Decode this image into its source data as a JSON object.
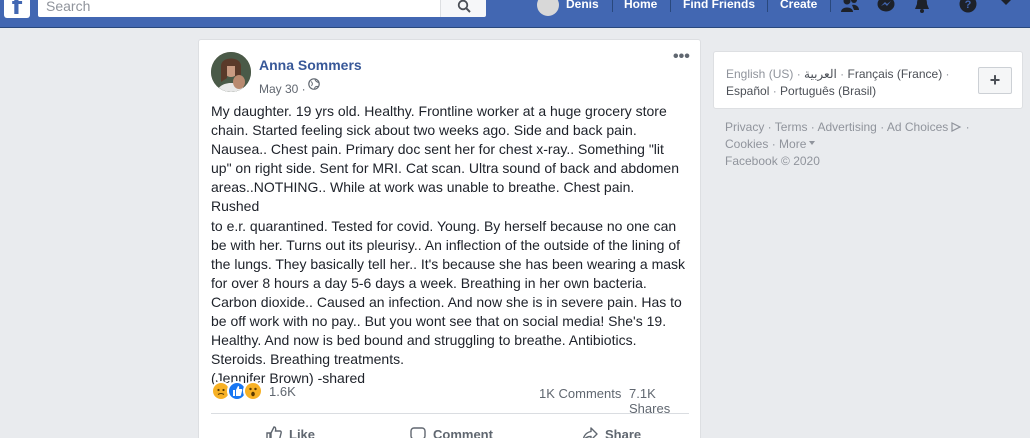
{
  "topbar": {
    "logo": "f",
    "search_placeholder": "Search",
    "user_name": "Denis",
    "nav": [
      "Home",
      "Find Friends",
      "Create"
    ]
  },
  "post": {
    "author": "Anna Sommers",
    "date": "May 30 ·",
    "body_lines": [
      "My daughter. 19 yrs old. Healthy. Frontline worker at a huge grocery store",
      "chain. Started feeling sick about two weeks ago. Side and back pain.",
      "Nausea.. Chest pain. Primary doc sent her for chest x-ray.. Something \"lit",
      "up\" on right side. Sent for MRI. Cat scan. Ultra sound of back and abdomen",
      "areas..NOTHING.. While at work was unable to breathe. Chest pain. Rushed",
      "to e.r. quarantined. Tested for covid. Young. By herself because no one can",
      "be with her. Turns out its pleurisy.. An inflection of the outside of the lining of",
      "the lungs. They basically tell her.. It's because she has been wearing a mask",
      "for over 8 hours a day 5-6 days a week. Breathing in her own bacteria.",
      "Carbon dioxide.. Caused an infection. And now she is in severe pain. Has to",
      "be off work with no pay.. But you wont see that on social media! She's 19.",
      "Healthy. And now is bed bound and struggling to breathe. Antibiotics.",
      "Steroids. Breathing treatments.",
      "(Jennifer Brown) -shared"
    ],
    "reaction_count": "1.6K",
    "comments": "1K Comments",
    "shares": "7.1K Shares",
    "actions": {
      "like": "Like",
      "comment": "Comment",
      "share": "Share"
    }
  },
  "languages": {
    "current": "English (US)",
    "sep": " · ",
    "items": [
      "العربية",
      "Français (France)",
      "Español",
      "Português (Brasil)"
    ],
    "add": "+"
  },
  "footer": {
    "links": [
      "Privacy",
      "Terms",
      "Advertising",
      "Ad Choices",
      "Cookies",
      "More"
    ],
    "copyright": "Facebook © 2020"
  },
  "colors": {
    "topbar": "#4267b2",
    "link": "#385898",
    "page_bg": "#e9ebee"
  }
}
